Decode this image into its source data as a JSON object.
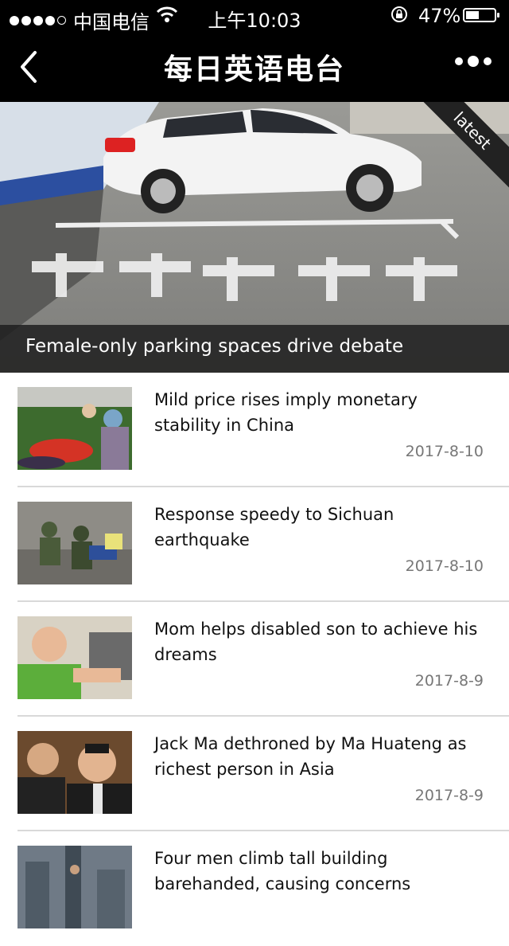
{
  "status_bar": {
    "carrier": "中国电信",
    "time": "上午10:03",
    "battery_percent": "47%",
    "battery_level": 0.47
  },
  "nav": {
    "title": "每日英语电台"
  },
  "hero": {
    "caption": "Female-only parking spaces drive debate",
    "ribbon": "latest"
  },
  "articles": [
    {
      "headline": "Mild price rises imply monetary stability in China",
      "date": "2017-8-10"
    },
    {
      "headline": "Response speedy to Sichuan earthquake",
      "date": "2017-8-10"
    },
    {
      "headline": "Mom helps disabled son to achieve his dreams",
      "date": "2017-8-9"
    },
    {
      "headline": "Jack Ma dethroned by Ma Huateng as richest person in Asia",
      "date": "2017-8-9"
    },
    {
      "headline": "Four men climb tall building barehanded, causing concerns",
      "date": ""
    }
  ]
}
